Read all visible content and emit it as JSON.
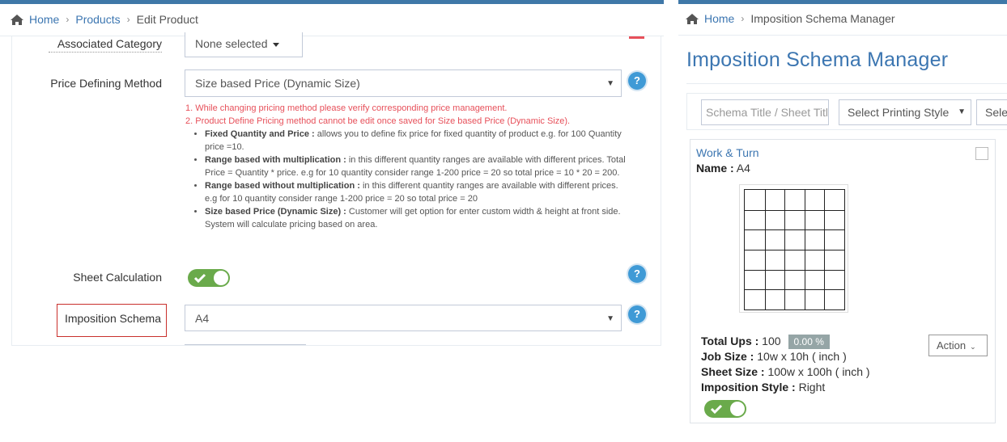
{
  "left": {
    "breadcrumb": {
      "home": "Home",
      "products": "Products",
      "current": "Edit Product"
    },
    "form": {
      "associated_category": {
        "label": "Associated Category",
        "value": "None selected"
      },
      "price_defining_method": {
        "label": "Price Defining Method",
        "value": "Size based Price (Dynamic Size)",
        "help": "?"
      },
      "notes": {
        "warning_1": "1. While changing pricing method please verify corresponding price management.",
        "warning_2": "2. Product Define Pricing method cannot be edit once saved for Size based Price (Dynamic Size).",
        "items": [
          {
            "title": "Fixed Quantity and Price :",
            "text": " allows you to define fix price for fixed quantity of product e.g. for 100 Quantity price =10."
          },
          {
            "title": "Range based with multiplication :",
            "text": " in this different quantity ranges are available with different prices. Total Price = Quantity * price. e.g for 10 quantity consider range 1-200 price = 20 so total price = 10 * 20 = 200."
          },
          {
            "title": "Range based without multiplication :",
            "text": " in this different quantity ranges are available with different prices. e.g for 10 quantity consider range 1-200 price = 20 so total price = 20"
          },
          {
            "title": "Size based Price (Dynamic Size) :",
            "text": " Customer will get option for enter custom width & height at front side. System will calculate pricing based on area."
          }
        ]
      },
      "sheet_calculation": {
        "label": "Sheet Calculation",
        "enabled": true,
        "help": "?"
      },
      "imposition_schema": {
        "label": "Imposition Schema",
        "value": "A4",
        "help": "?"
      }
    }
  },
  "right": {
    "breadcrumb": {
      "home": "Home",
      "current": "Imposition Schema Manager"
    },
    "title": "Imposition Schema Manager",
    "filters": {
      "search_placeholder": "Schema Title / Sheet Title",
      "printing_style": "Select Printing Style",
      "third": "Select"
    },
    "card": {
      "title": "Work & Turn",
      "name_label": "Name :",
      "name_value": " A4",
      "grid": {
        "cols": 5,
        "rows": 6
      },
      "total_ups_label": "Total Ups :",
      "total_ups_value": " 100",
      "percent": "0.00 %",
      "job_size_label": "Job Size :",
      "job_size_value": " 10w x 10h ( inch )",
      "sheet_size_label": "Sheet Size :",
      "sheet_size_value": " 100w x 100h ( inch )",
      "imposition_style_label": "Imposition Style :",
      "imposition_style_value": " Right",
      "action_label": "Action",
      "active": true
    }
  },
  "colors": {
    "accent": "#3c76b1",
    "topbar": "#3f78a8",
    "toggle_on": "#6aaa4b",
    "warning": "#e7505a",
    "help": "#3f9ad6"
  }
}
